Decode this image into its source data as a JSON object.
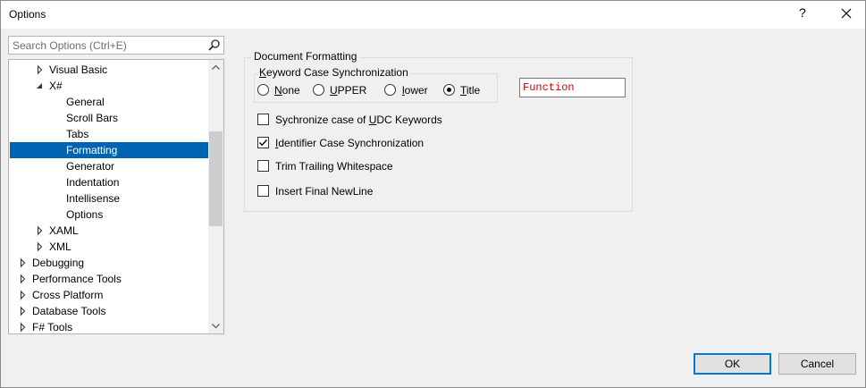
{
  "window": {
    "title": "Options",
    "help_glyph": "?",
    "close_glyph": "close"
  },
  "search": {
    "placeholder": "Search Options (Ctrl+E)",
    "value": ""
  },
  "tree": {
    "items": [
      {
        "label": "Visual Basic",
        "level": 1,
        "expander": "collapsed",
        "selected": false
      },
      {
        "label": "X#",
        "level": 1,
        "expander": "expanded",
        "selected": false
      },
      {
        "label": "General",
        "level": 2,
        "expander": "none",
        "selected": false
      },
      {
        "label": "Scroll Bars",
        "level": 2,
        "expander": "none",
        "selected": false
      },
      {
        "label": "Tabs",
        "level": 2,
        "expander": "none",
        "selected": false
      },
      {
        "label": "Formatting",
        "level": 2,
        "expander": "none",
        "selected": true
      },
      {
        "label": "Generator",
        "level": 2,
        "expander": "none",
        "selected": false
      },
      {
        "label": "Indentation",
        "level": 2,
        "expander": "none",
        "selected": false
      },
      {
        "label": "Intellisense",
        "level": 2,
        "expander": "none",
        "selected": false
      },
      {
        "label": "Options",
        "level": 2,
        "expander": "none",
        "selected": false
      },
      {
        "label": "XAML",
        "level": 1,
        "expander": "collapsed",
        "selected": false
      },
      {
        "label": "XML",
        "level": 1,
        "expander": "collapsed",
        "selected": false
      },
      {
        "label": "Debugging",
        "level": 0,
        "expander": "collapsed",
        "selected": false
      },
      {
        "label": "Performance Tools",
        "level": 0,
        "expander": "collapsed",
        "selected": false
      },
      {
        "label": "Cross Platform",
        "level": 0,
        "expander": "collapsed",
        "selected": false
      },
      {
        "label": "Database Tools",
        "level": 0,
        "expander": "collapsed",
        "selected": false
      },
      {
        "label": "F# Tools",
        "level": 0,
        "expander": "collapsed",
        "selected": false
      }
    ],
    "scroll_position": 0.38
  },
  "document_formatting": {
    "title": "Document Formatting",
    "keyword_case": {
      "title": "Keyword Case Synchronization",
      "title_mnemonic": "K",
      "options": [
        {
          "label": "None",
          "mnemonic": "N",
          "rest": "one",
          "checked": false
        },
        {
          "label": "UPPER",
          "mnemonic": "U",
          "rest": "PPER",
          "checked": false
        },
        {
          "label": "lower",
          "mnemonic": "l",
          "rest": "ower",
          "checked": false
        },
        {
          "label": "Title",
          "mnemonic": "T",
          "rest": "itle",
          "checked": true
        }
      ],
      "preview": "Function"
    },
    "checkboxes": [
      {
        "label_pre": "Sychronize case of ",
        "mnemonic": "U",
        "label_post": "DC Keywords",
        "checked": false
      },
      {
        "label_pre": "",
        "mnemonic": "I",
        "label_post": "dentifier Case Synchronization",
        "checked": true
      },
      {
        "label_pre": "Trim Trailing Whitespace",
        "mnemonic": "",
        "label_post": "",
        "checked": false
      },
      {
        "label_pre": "Insert Final NewLine",
        "mnemonic": "",
        "label_post": "",
        "checked": false
      }
    ]
  },
  "buttons": {
    "ok": "OK",
    "cancel": "Cancel"
  },
  "colors": {
    "selection": "#0063b1",
    "preview_text": "#d40000",
    "default_button_border": "#0078d7"
  }
}
